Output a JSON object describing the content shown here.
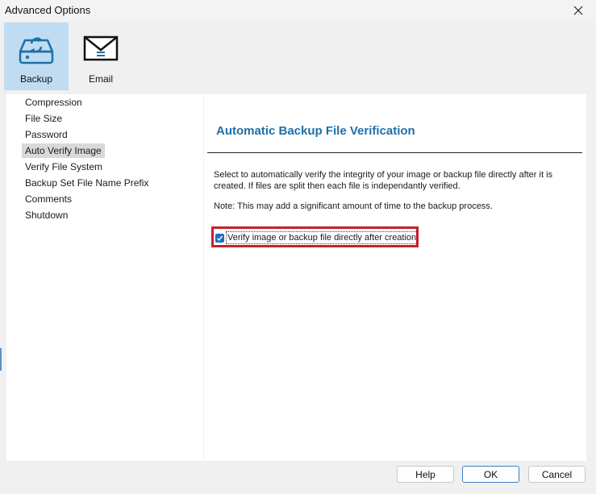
{
  "window": {
    "title": "Advanced Options"
  },
  "toolbar": [
    {
      "label": "Backup",
      "icon": "backup-drive-icon",
      "selected": true
    },
    {
      "label": "Email",
      "icon": "envelope-icon",
      "selected": false
    }
  ],
  "nav": {
    "items": [
      {
        "label": "Compression"
      },
      {
        "label": "File Size"
      },
      {
        "label": "Password"
      },
      {
        "label": "Auto Verify Image",
        "active": true
      },
      {
        "label": "Verify File System"
      },
      {
        "label": "Backup Set File Name Prefix"
      },
      {
        "label": "Comments"
      },
      {
        "label": "Shutdown"
      }
    ]
  },
  "content": {
    "title": "Automatic Backup File Verification",
    "description": "Select to automatically verify the integrity of your image or backup file directly after it is created. If files are split then each file is independantly verified.",
    "note": "Note: This may add a significant amount of time to the backup process.",
    "checkbox_label": "Verify image or backup file directly after creation",
    "checkbox_checked": true
  },
  "buttons": {
    "help": "Help",
    "ok": "OK",
    "cancel": "Cancel"
  },
  "colors": {
    "accent": "#1f6fa8",
    "selected_tool": "#bfdcf2",
    "highlight_box": "#c8202a",
    "checkbox": "#1c6fc2"
  }
}
